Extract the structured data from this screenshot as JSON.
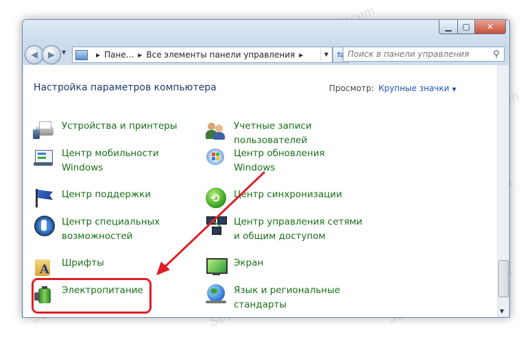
{
  "watermark": "Sovingpergepair.com",
  "address": {
    "crumb1": "Пане...",
    "crumb2": "Все элементы панели управления"
  },
  "search": {
    "placeholder": "Поиск в панели управления"
  },
  "header": {
    "title": "Настройка параметров компьютера",
    "view_label": "Просмотр:",
    "view_value": "Крупные значки"
  },
  "items": {
    "devices": "Устройства и принтеры",
    "accounts": "Учетные записи пользователей",
    "mobility": "Центр мобильности Windows",
    "update": "Центр обновления Windows",
    "support": "Центр поддержки",
    "sync": "Центр синхронизации",
    "access": "Центр специальных возможностей",
    "network": "Центр управления сетями и общим доступом",
    "fonts": "Шрифты",
    "screen": "Экран",
    "power": "Электропитание",
    "region": "Язык и региональные стандарты"
  },
  "colors": {
    "link": "#1a6e1a",
    "heading": "#1e3a6e",
    "highlight": "#e01c24"
  },
  "icons": [
    "printer-icon",
    "users-icon",
    "mobility-icon",
    "windows-update-icon",
    "flag-icon",
    "sync-icon",
    "accessibility-icon",
    "network-icon",
    "fonts-icon",
    "monitor-icon",
    "battery-icon",
    "globe-icon",
    "search-icon"
  ]
}
